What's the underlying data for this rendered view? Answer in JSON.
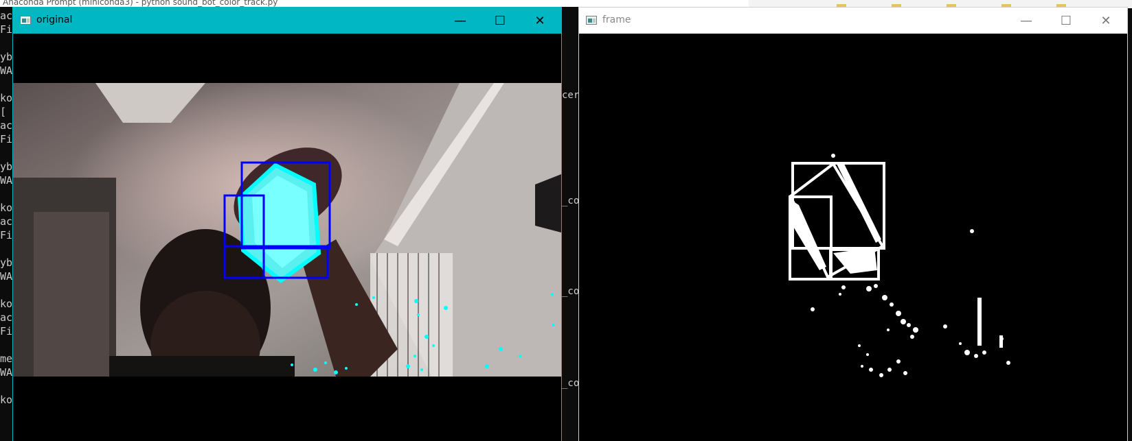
{
  "console": {
    "title_fragment": "Anaconda Prompt (miniconda3) - python  sound_bot_color_track.py",
    "lines": [
      "ac",
      "Fi",
      "",
      "yb",
      "WA",
      "",
      "ko",
      "[",
      "ac",
      "Fi",
      "",
      "yb",
      "WA",
      "",
      "ko",
      "ac",
      "Fi",
      "",
      "yb",
      "WA",
      "",
      "ko",
      "ac",
      "Fi",
      "",
      "me",
      "WA",
      "",
      "ko"
    ],
    "mid_fragments": [
      "cer",
      "_co",
      "_co",
      "_co"
    ]
  },
  "windows": {
    "original": {
      "title": "original",
      "minimize_symbol": "—",
      "maximize_symbol": "☐",
      "close_symbol": "✕",
      "highlight_color": "#00ffff",
      "box_color": "#0000ff"
    },
    "frame": {
      "title": "frame",
      "minimize_symbol": "—",
      "maximize_symbol": "☐",
      "close_symbol": "✕",
      "mask_color": "#ffffff"
    }
  }
}
